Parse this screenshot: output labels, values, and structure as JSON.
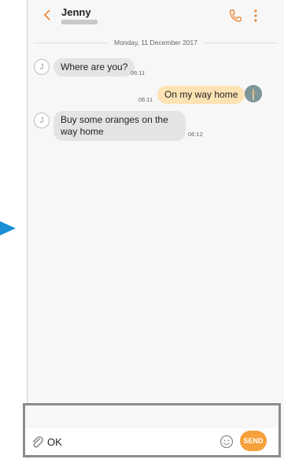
{
  "header": {
    "contact_name": "Jenny",
    "icons": [
      "chevron-left-icon",
      "phone-icon",
      "more-vert-icon"
    ]
  },
  "conversation": {
    "date": "Monday, 11 December 2017",
    "messages": [
      {
        "direction": "in",
        "text": "Where are you?",
        "time": "06:11"
      },
      {
        "direction": "out",
        "text": "On my way home",
        "time": "06:11"
      },
      {
        "direction": "in",
        "text": "Buy some oranges on the way home",
        "time": "06:12"
      }
    ],
    "avatar_initial": "J"
  },
  "composer": {
    "value": "OK",
    "send_label": "SEND"
  },
  "colors": {
    "accent": "#f5a03a",
    "outgoing_bubble": "#fde3b4",
    "incoming_bubble": "#e4e4e4",
    "pointer_arrow": "#1a8fd6"
  }
}
